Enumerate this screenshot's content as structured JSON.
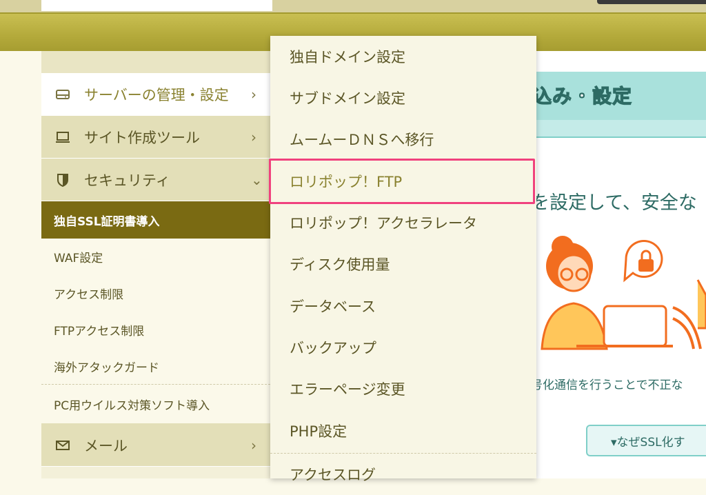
{
  "sidebar": {
    "nav": [
      {
        "label": "サーバーの管理・設定",
        "chevron": "›",
        "icon": "server-icon"
      },
      {
        "label": "サイト作成ツール",
        "chevron": "›",
        "icon": "laptop-icon"
      },
      {
        "label": "セキュリティ",
        "chevron": "⌄",
        "icon": "shield-icon"
      }
    ],
    "security_items": [
      "独自SSL証明書導入",
      "WAF設定",
      "アクセス制限",
      "FTPアクセス制限",
      "海外アタックガード",
      "PC用ウイルス対策ソフト導入"
    ],
    "mail": {
      "label": "メール",
      "chevron": "›",
      "icon": "mail-icon"
    }
  },
  "dropdown": {
    "items": [
      "独自ドメイン設定",
      "サブドメイン設定",
      "ムームーＤＮＳへ移行",
      "ロリポップ！FTP",
      "ロリポップ！アクセラレータ",
      "ディスク使用量",
      "データベース",
      "バックアップ",
      "エラーページ変更",
      "PHP設定",
      "アクセスログ"
    ]
  },
  "content": {
    "heading": "込み・設定",
    "lead": "を設定して、安全な",
    "small": "号化通信を行うことで不正な",
    "why_button": "▾なぜSSL化す"
  },
  "colors": {
    "highlight": "#f0417e",
    "accent": "#7a6a12",
    "teal": "#a9e1dc"
  }
}
